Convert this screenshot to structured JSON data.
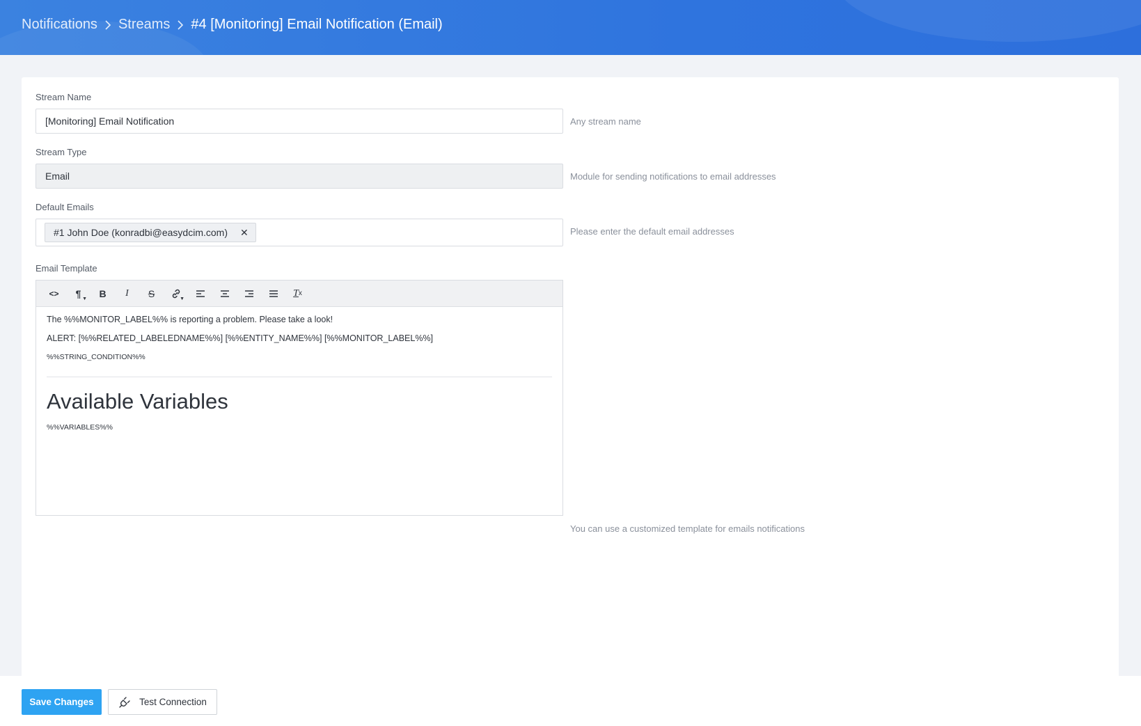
{
  "breadcrumb": {
    "items": [
      "Notifications",
      "Streams",
      "#4 [Monitoring] Email Notification (Email)"
    ]
  },
  "form": {
    "stream_name": {
      "label": "Stream Name",
      "value": "[Monitoring] Email Notification",
      "help": "Any stream name"
    },
    "stream_type": {
      "label": "Stream Type",
      "value": "Email",
      "help": "Module for sending notifications to email addresses"
    },
    "default_emails": {
      "label": "Default Emails",
      "tags": [
        "#1 John Doe (konradbi@easydcim.com)"
      ],
      "help": "Please enter the default email addresses"
    },
    "email_template": {
      "label": "Email Template",
      "help": "You can use a customized template for emails notifications",
      "toolbar": [
        {
          "name": "code-view-icon",
          "glyph": "<>"
        },
        {
          "name": "paragraph-icon",
          "glyph": "¶"
        },
        {
          "name": "bold-icon",
          "glyph": "B"
        },
        {
          "name": "italic-icon",
          "glyph": "I"
        },
        {
          "name": "strikethrough-icon",
          "glyph": "S"
        },
        {
          "name": "link-icon",
          "glyph": "link"
        },
        {
          "name": "align-left-icon",
          "glyph": "align-left"
        },
        {
          "name": "align-center-icon",
          "glyph": "align-center"
        },
        {
          "name": "align-right-icon",
          "glyph": "align-right"
        },
        {
          "name": "align-justify-icon",
          "glyph": "align-justify"
        },
        {
          "name": "clear-format-icon",
          "glyph": "Tx"
        }
      ],
      "content": {
        "line1_prefix": "The ",
        "line1_var": "%%MONITOR_LABEL%%",
        "line1_suffix": " is reporting a problem. Please take a look!",
        "line2": "ALERT: [%%RELATED_LABELEDNAME%%] [%%ENTITY_NAME%%] [%%MONITOR_LABEL%%]",
        "line3": "%%STRING_CONDITION%%",
        "heading": "Available Variables",
        "variables": "%%VARIABLES%%"
      }
    }
  },
  "footer": {
    "save_label": "Save Changes",
    "test_label": "Test Connection"
  },
  "colors": {
    "header": "#2f74de",
    "primary_button": "#2ea3f2"
  }
}
